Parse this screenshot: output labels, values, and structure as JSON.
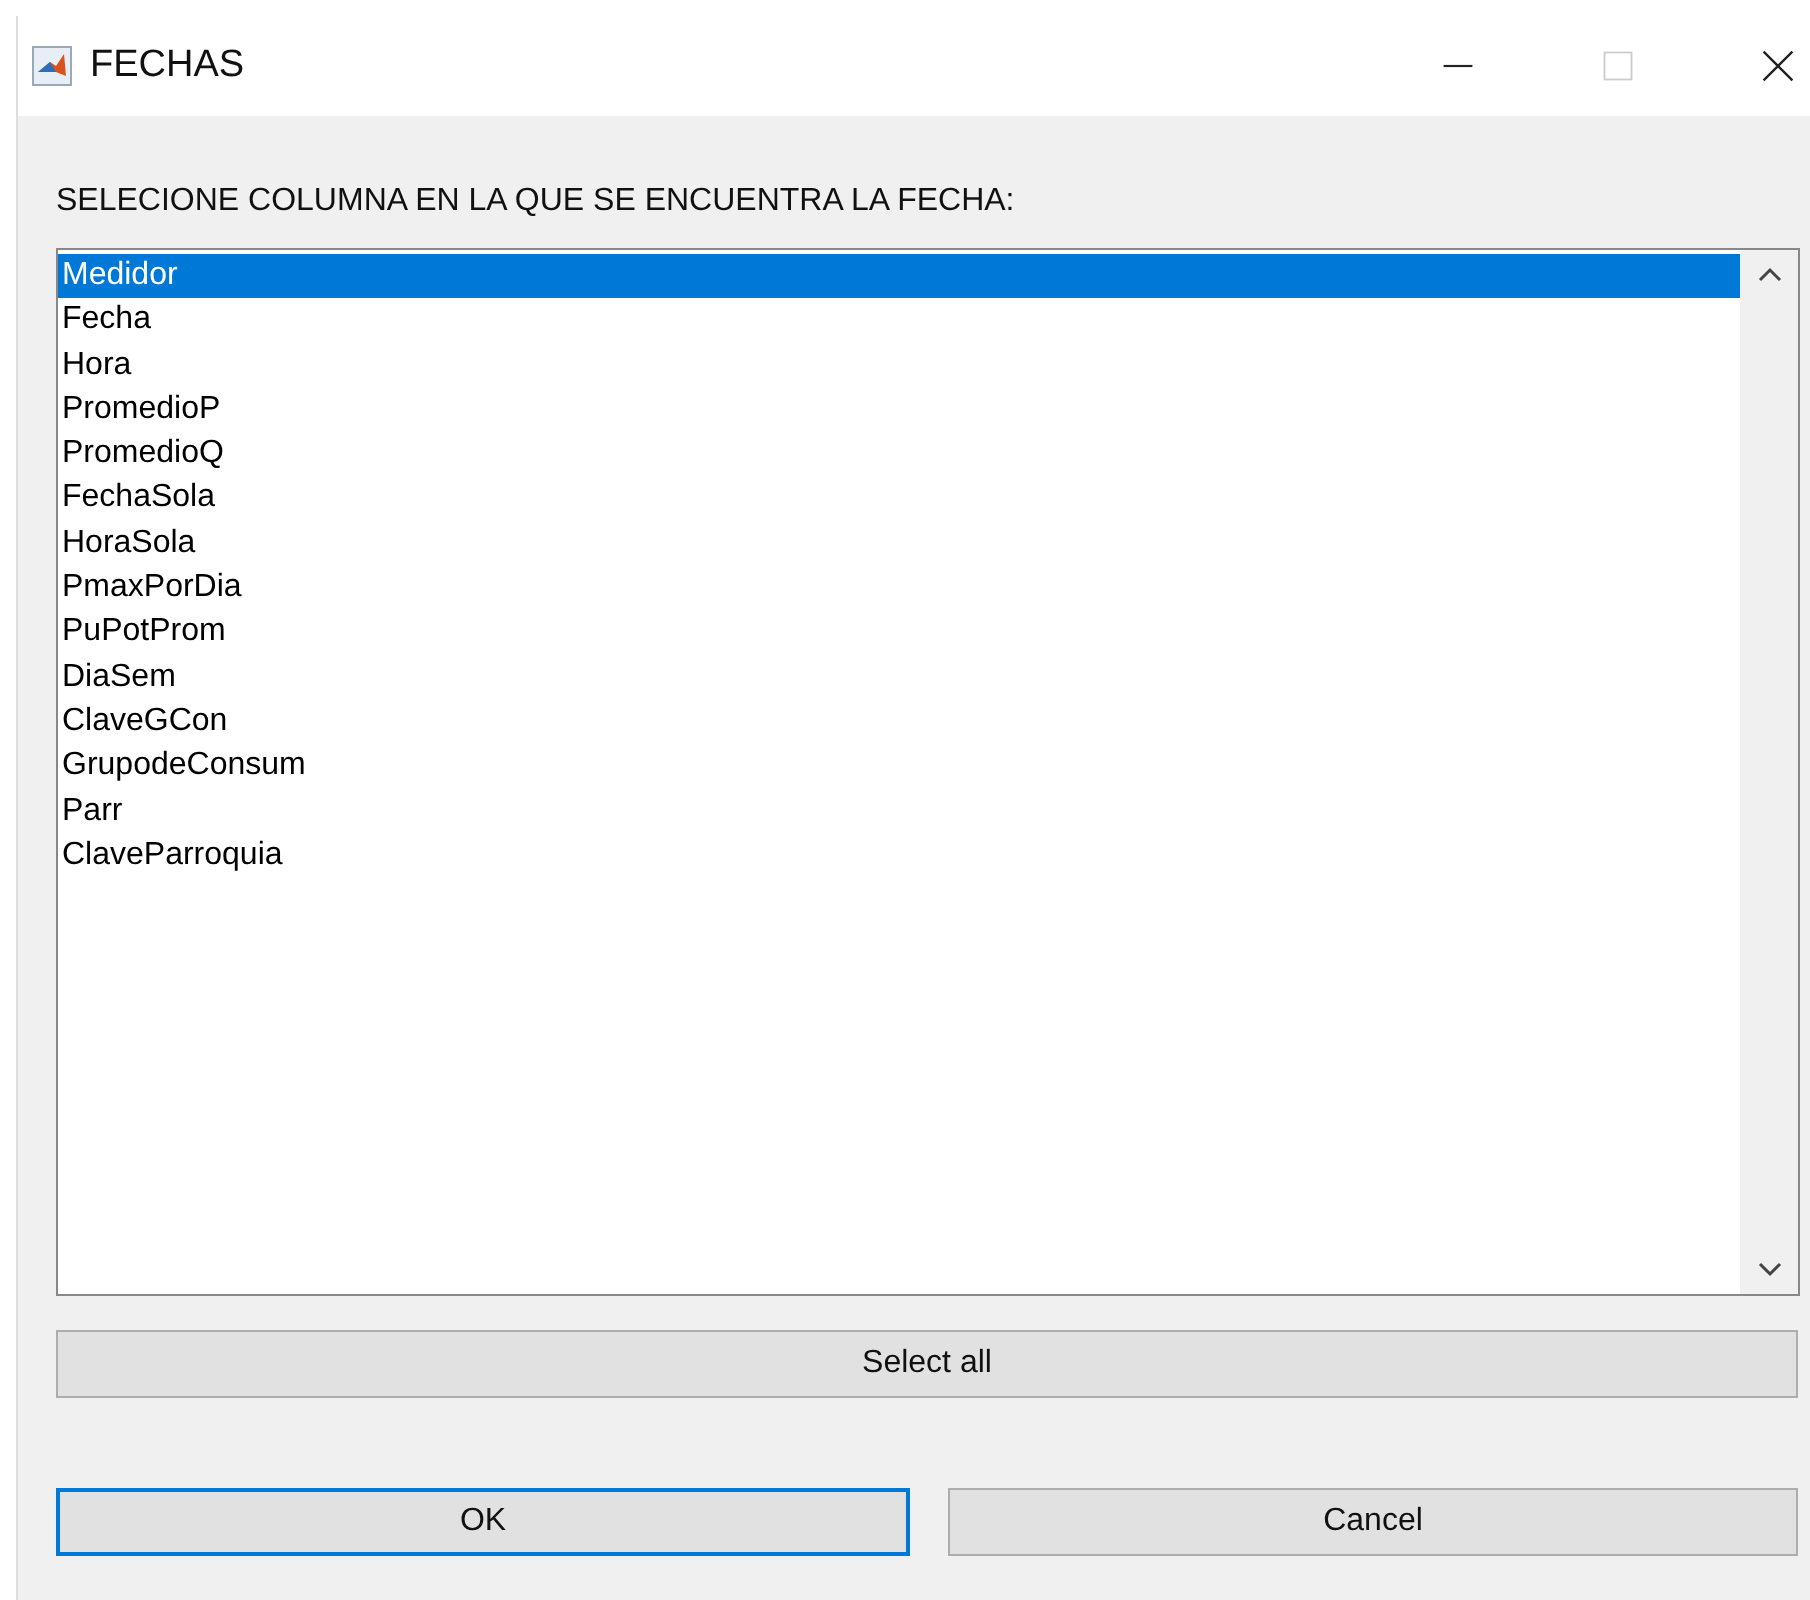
{
  "window": {
    "title": "FECHAS"
  },
  "prompt": "SELECIONE COLUMNA EN LA QUE SE ENCUENTRA LA FECHA:",
  "list_items": [
    {
      "label": "Medidor",
      "selected": true
    },
    {
      "label": "Fecha",
      "selected": false
    },
    {
      "label": "Hora",
      "selected": false
    },
    {
      "label": "PromedioP",
      "selected": false
    },
    {
      "label": "PromedioQ",
      "selected": false
    },
    {
      "label": "FechaSola",
      "selected": false
    },
    {
      "label": "HoraSola",
      "selected": false
    },
    {
      "label": "PmaxPorDia",
      "selected": false
    },
    {
      "label": "PuPotProm",
      "selected": false
    },
    {
      "label": "DiaSem",
      "selected": false
    },
    {
      "label": "ClaveGCon",
      "selected": false
    },
    {
      "label": "GrupodeConsum",
      "selected": false
    },
    {
      "label": "Parr",
      "selected": false
    },
    {
      "label": "ClaveParroquia",
      "selected": false
    }
  ],
  "select_all": "Select all",
  "buttons": [
    {
      "label": "OK",
      "focused": true
    },
    {
      "label": "Cancel",
      "focused": false
    }
  ]
}
